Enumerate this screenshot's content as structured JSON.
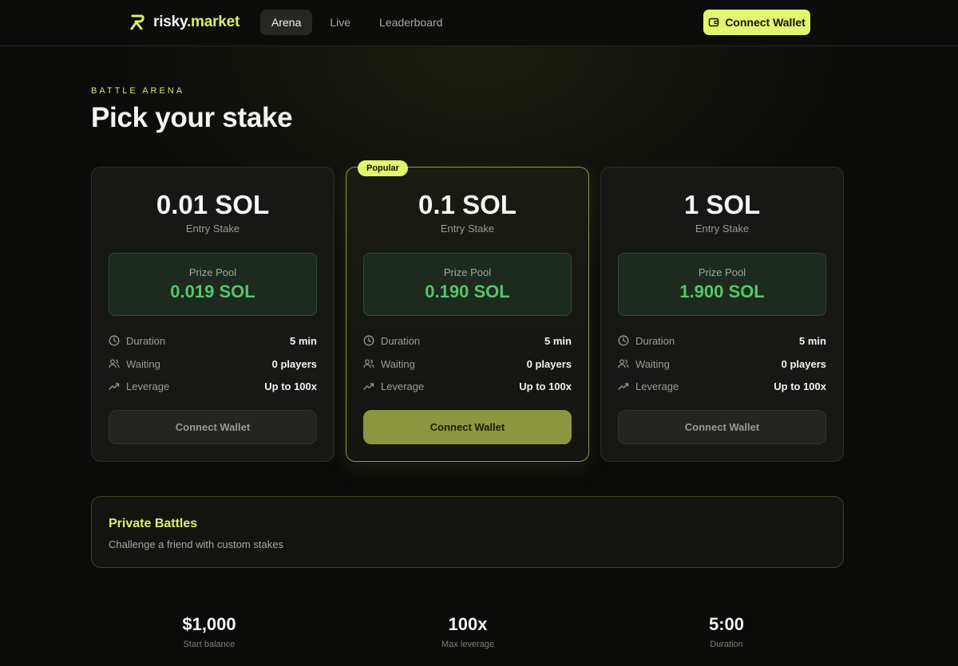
{
  "nav": {
    "logo": {
      "part1": "risky",
      "part2": ".market"
    },
    "links": [
      {
        "label": "Arena",
        "active": true
      },
      {
        "label": "Live",
        "active": false
      },
      {
        "label": "Leaderboard",
        "active": false
      }
    ],
    "connect_label": "Connect Wallet"
  },
  "header": {
    "eyebrow": "BATTLE ARENA",
    "title": "Pick your stake"
  },
  "cards": [
    {
      "stake": "0.01 SOL",
      "stake_label": "Entry Stake",
      "pool_label": "Prize Pool",
      "pool_value": "0.019 SOL",
      "rows": [
        {
          "label": "Duration",
          "value": "5 min",
          "icon": "clock-icon"
        },
        {
          "label": "Waiting",
          "value": "0 players",
          "icon": "users-icon"
        },
        {
          "label": "Leverage",
          "value": "Up to 100x",
          "icon": "trending-up-icon"
        }
      ],
      "button": "Connect Wallet",
      "featured": false
    },
    {
      "badge": "Popular",
      "stake": "0.1 SOL",
      "stake_label": "Entry Stake",
      "pool_label": "Prize Pool",
      "pool_value": "0.190 SOL",
      "rows": [
        {
          "label": "Duration",
          "value": "5 min",
          "icon": "clock-icon"
        },
        {
          "label": "Waiting",
          "value": "0 players",
          "icon": "users-icon"
        },
        {
          "label": "Leverage",
          "value": "Up to 100x",
          "icon": "trending-up-icon"
        }
      ],
      "button": "Connect Wallet",
      "featured": true
    },
    {
      "stake": "1 SOL",
      "stake_label": "Entry Stake",
      "pool_label": "Prize Pool",
      "pool_value": "1.900 SOL",
      "rows": [
        {
          "label": "Duration",
          "value": "5 min",
          "icon": "clock-icon"
        },
        {
          "label": "Waiting",
          "value": "0 players",
          "icon": "users-icon"
        },
        {
          "label": "Leverage",
          "value": "Up to 100x",
          "icon": "trending-up-icon"
        }
      ],
      "button": "Connect Wallet",
      "featured": false
    }
  ],
  "private": {
    "title": "Private Battles",
    "subtitle": "Challenge a friend with custom stakes"
  },
  "stats": [
    {
      "value": "$1,000",
      "label": "Start balance"
    },
    {
      "value": "100x",
      "label": "Max leverage"
    },
    {
      "value": "5:00",
      "label": "Duration"
    }
  ],
  "colors": {
    "accent": "#e2f56f",
    "pool_green": "#57c46c",
    "featured_button": "#8c953f",
    "background": "#0b0b0a"
  }
}
